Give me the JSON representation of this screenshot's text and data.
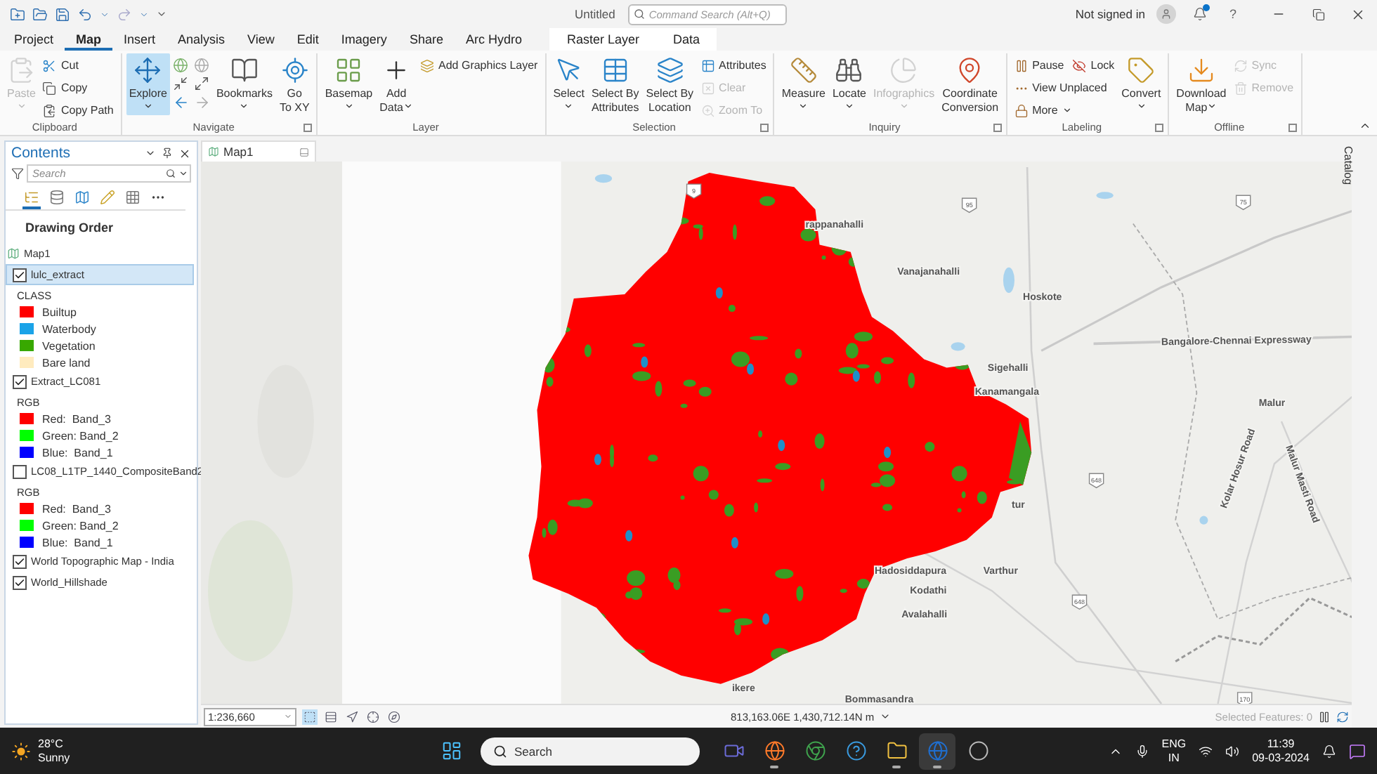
{
  "title_bar": {
    "title": "Untitled",
    "search_placeholder": "Command Search (Alt+Q)",
    "account": "Not signed in",
    "has_notification": true,
    "help": "?"
  },
  "tabs": [
    {
      "label": "Project",
      "selected": false,
      "contextual": false
    },
    {
      "label": "Map",
      "selected": true,
      "contextual": false
    },
    {
      "label": "Insert",
      "selected": false,
      "contextual": false
    },
    {
      "label": "Analysis",
      "selected": false,
      "contextual": false
    },
    {
      "label": "View",
      "selected": false,
      "contextual": false
    },
    {
      "label": "Edit",
      "selected": false,
      "contextual": false
    },
    {
      "label": "Imagery",
      "selected": false,
      "contextual": false
    },
    {
      "label": "Share",
      "selected": false,
      "contextual": false
    },
    {
      "label": "Arc Hydro",
      "selected": false,
      "contextual": false
    },
    {
      "label": "Raster Layer",
      "selected": false,
      "contextual": true
    },
    {
      "label": "Data",
      "selected": false,
      "contextual": true
    }
  ],
  "ribbon": {
    "groups": [
      {
        "title": "Clipboard",
        "launcher": false,
        "controls": [
          {
            "kind": "large",
            "label": "Paste",
            "dropdown": true,
            "disabled": true,
            "selected": false
          },
          {
            "kind": "stack",
            "rows": [
              [
                {
                  "label": "Cut",
                  "disabled": false
                }
              ],
              [
                {
                  "label": "Copy",
                  "disabled": false
                }
              ],
              [
                {
                  "label": "Copy Path",
                  "disabled": false
                }
              ]
            ]
          }
        ]
      },
      {
        "title": "Navigate",
        "launcher": true,
        "controls": [
          {
            "kind": "large",
            "label": "Explore",
            "dropdown": true,
            "disabled": false,
            "selected": true
          },
          {
            "kind": "nav_tools"
          },
          {
            "kind": "large",
            "label": "Bookmarks",
            "dropdown": true,
            "disabled": false,
            "selected": false
          },
          {
            "kind": "large",
            "label": "Go\nTo XY",
            "dropdown": false,
            "disabled": false,
            "selected": false
          }
        ]
      },
      {
        "title": "Layer",
        "launcher": false,
        "controls": [
          {
            "kind": "large",
            "label": "Basemap",
            "dropdown": true,
            "disabled": false,
            "selected": false
          },
          {
            "kind": "large",
            "label": "Add\nData",
            "dropdown": true,
            "disabled": false,
            "selected": false
          },
          {
            "kind": "stack",
            "rows": [
              [
                {
                  "label": "Add Graphics Layer",
                  "disabled": false
                }
              ]
            ]
          }
        ]
      },
      {
        "title": "Selection",
        "launcher": true,
        "controls": [
          {
            "kind": "large",
            "label": "Select",
            "dropdown": true,
            "disabled": false,
            "selected": false
          },
          {
            "kind": "large",
            "label": "Select By\nAttributes",
            "dropdown": false,
            "disabled": false,
            "selected": false
          },
          {
            "kind": "large",
            "label": "Select By\nLocation",
            "dropdown": false,
            "disabled": false,
            "selected": false
          },
          {
            "kind": "stack",
            "rows": [
              [
                {
                  "label": "Attributes",
                  "disabled": false
                }
              ],
              [
                {
                  "label": "Clear",
                  "disabled": true
                }
              ],
              [
                {
                  "label": "Zoom To",
                  "disabled": true
                }
              ]
            ]
          }
        ]
      },
      {
        "title": "Inquiry",
        "launcher": true,
        "controls": [
          {
            "kind": "large",
            "label": "Measure",
            "dropdown": true,
            "disabled": false,
            "selected": false
          },
          {
            "kind": "large",
            "label": "Locate",
            "dropdown": true,
            "disabled": false,
            "selected": false
          },
          {
            "kind": "large",
            "label": "Infographics",
            "dropdown": true,
            "disabled": true,
            "selected": false
          },
          {
            "kind": "large",
            "label": "Coordinate\nConversion",
            "dropdown": false,
            "disabled": false,
            "selected": false
          }
        ]
      },
      {
        "title": "Labeling",
        "launcher": true,
        "controls": [
          {
            "kind": "stack",
            "rows": [
              [
                {
                  "label": "Pause",
                  "disabled": false
                },
                {
                  "label": "Lock",
                  "disabled": false
                }
              ],
              [
                {
                  "label": "View Unplaced",
                  "disabled": false
                }
              ],
              [
                {
                  "label": "More",
                  "disabled": false,
                  "dropdown": true
                }
              ]
            ]
          },
          {
            "kind": "large",
            "label": "Convert",
            "dropdown": true,
            "disabled": false,
            "selected": false
          }
        ]
      },
      {
        "title": "Offline",
        "launcher": true,
        "controls": [
          {
            "kind": "large",
            "label": "Download\nMap",
            "dropdown": true,
            "disabled": false,
            "selected": false
          },
          {
            "kind": "stack",
            "rows": [
              [
                {
                  "label": "Sync",
                  "disabled": true
                }
              ],
              [
                {
                  "label": "Remove",
                  "disabled": true
                }
              ]
            ]
          }
        ]
      }
    ]
  },
  "contents": {
    "title": "Contents",
    "search_placeholder": "Search",
    "views": [
      {
        "selected": true
      },
      {
        "selected": false
      },
      {
        "selected": false
      },
      {
        "selected": false
      },
      {
        "selected": false
      }
    ],
    "heading": "Drawing Order",
    "tree": [
      {
        "name": "Map1",
        "kind": "map",
        "children": [
          {
            "name": "lulc_extract",
            "kind": "layer",
            "checked": true,
            "selected": true,
            "legend": {
              "heading": "CLASS",
              "entries": [
                {
                  "label": "Builtup",
                  "color": "#ff0000"
                },
                {
                  "label": "Waterbody",
                  "color": "#1aa3e8"
                },
                {
                  "label": "Vegetation",
                  "color": "#38a800"
                },
                {
                  "label": "Bare land",
                  "color": "#ffebbe"
                }
              ]
            }
          },
          {
            "name": "Extract_LC081",
            "kind": "layer",
            "checked": true,
            "selected": false,
            "legend": {
              "heading": "RGB",
              "entries": [
                {
                  "label": "Red:  Band_3",
                  "color": "#ff0000"
                },
                {
                  "label": "Green: Band_2",
                  "color": "#00ff00"
                },
                {
                  "label": "Blue:  Band_1",
                  "color": "#0000ff"
                }
              ]
            }
          },
          {
            "name": "LC08_L1TP_1440_CompositeBand2",
            "kind": "layer",
            "checked": false,
            "selected": false,
            "legend": {
              "heading": "RGB",
              "entries": [
                {
                  "label": "Red:  Band_3",
                  "color": "#ff0000"
                },
                {
                  "label": "Green: Band_2",
                  "color": "#00ff00"
                },
                {
                  "label": "Blue:  Band_1",
                  "color": "#0000ff"
                }
              ]
            }
          },
          {
            "name": "World Topographic Map - India",
            "kind": "layer",
            "checked": true,
            "selected": false
          },
          {
            "name": "World_Hillshade",
            "kind": "layer",
            "checked": true,
            "selected": false
          }
        ]
      }
    ]
  },
  "map": {
    "tab": "Map1",
    "place_labels": [
      "rappanahalli",
      "Vanajanahalli",
      "Hoskote",
      "Sigehalli",
      "Kanamangala",
      "Bangalore-Chennai Expressway",
      "Malur",
      "Kolar Hosur Road",
      "Malur Masti Road",
      "tur",
      "Hadosiddapura",
      "Varthur",
      "Kodathi",
      "Avalahalli",
      "ikere",
      "Bommasandra"
    ],
    "route_shields": [
      "9",
      "95",
      "75",
      "648",
      "648",
      "170"
    ],
    "scale": "1:236,660",
    "tools": [
      {
        "selected": true
      },
      {
        "selected": false
      },
      {
        "selected": false
      },
      {
        "selected": false
      },
      {
        "selected": false
      }
    ],
    "coordinates": "813,163.06E 1,430,712.14N m",
    "selected_features": "Selected Features: 0"
  },
  "catalog_tab": "Catalog",
  "taskbar": {
    "temperature": "28°C",
    "condition": "Sunny",
    "search_placeholder": "Search",
    "apps": [
      {
        "running": false
      },
      {
        "running": true
      },
      {
        "running": false
      },
      {
        "running": false
      },
      {
        "running": true
      },
      {
        "running": true
      },
      {
        "running": false
      }
    ],
    "language": "ENG",
    "region": "IN",
    "time": "11:39",
    "date": "09-03-2024"
  }
}
